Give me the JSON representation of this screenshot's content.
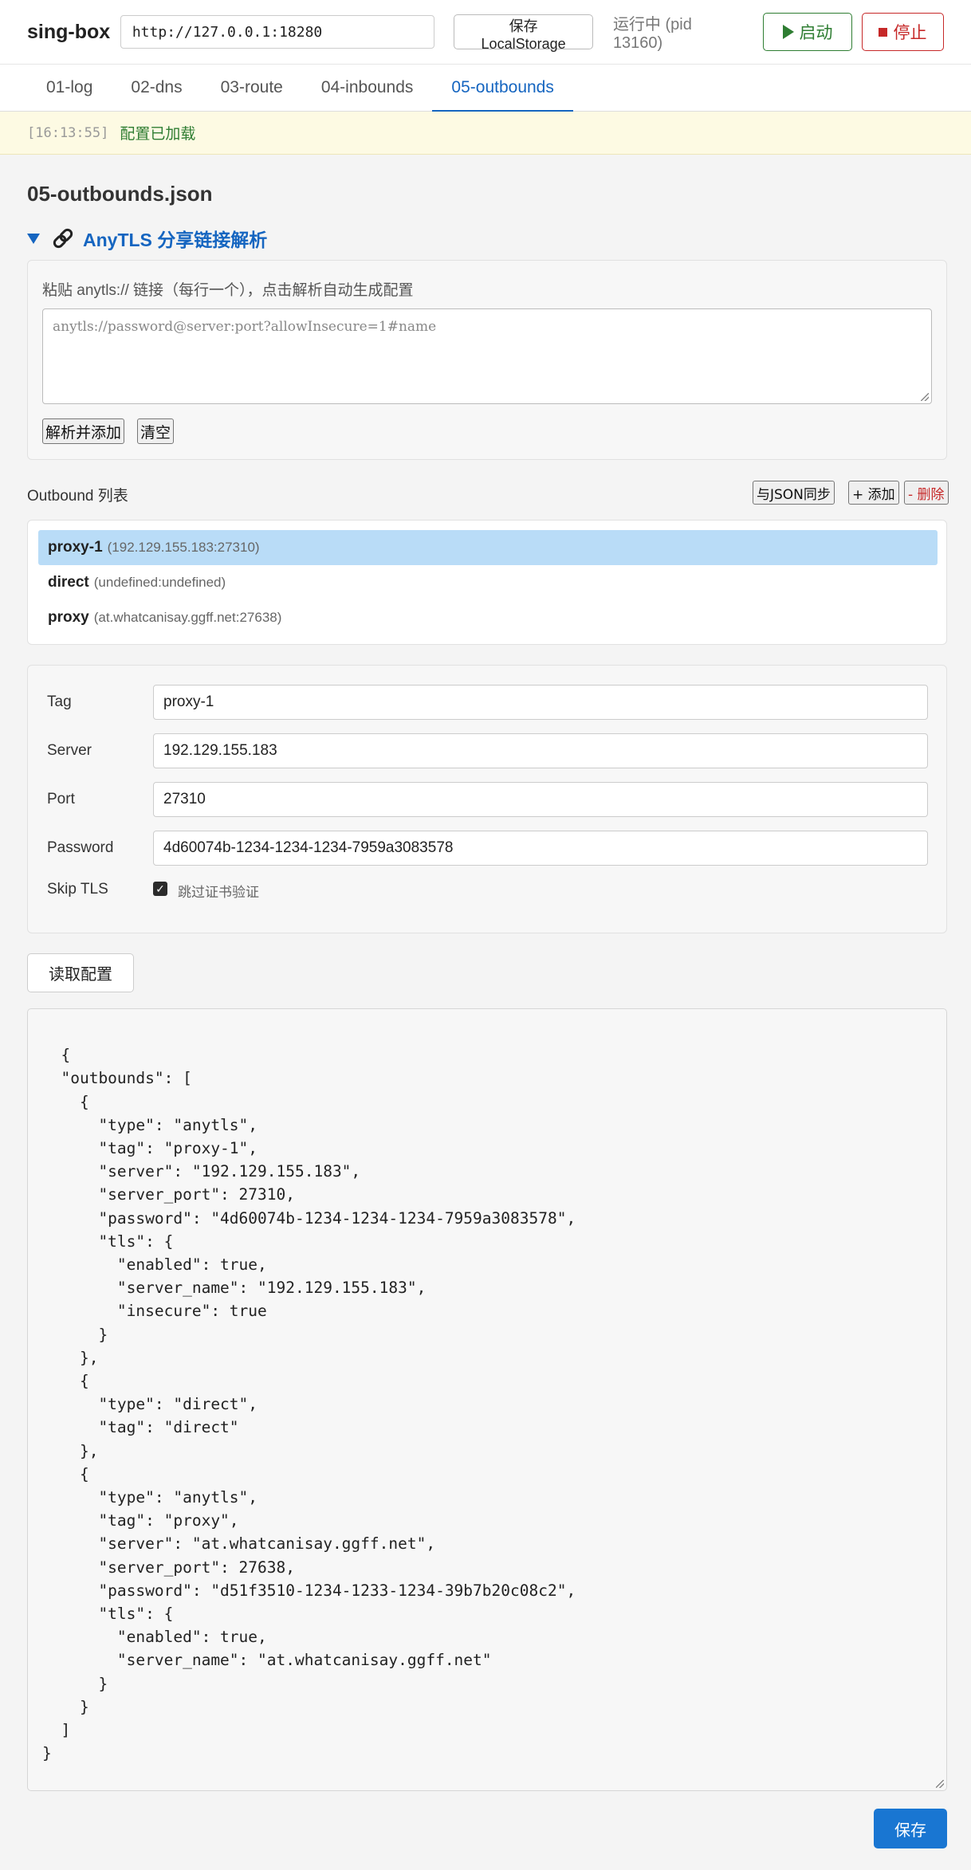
{
  "header": {
    "brand": "sing-box",
    "url_value": "http://127.0.0.1:18280",
    "save_storage_label": "保存LocalStorage",
    "status": "运行中 (pid 13160)",
    "start_label": "启动",
    "stop_label": "停止"
  },
  "tabs": [
    {
      "label": "01-log"
    },
    {
      "label": "02-dns"
    },
    {
      "label": "03-route"
    },
    {
      "label": "04-inbounds"
    },
    {
      "label": "05-outbounds",
      "active": true
    }
  ],
  "notice": {
    "timestamp": "[16:13:55]",
    "message": "配置已加载"
  },
  "page": {
    "title": "05-outbounds.json"
  },
  "parser": {
    "title": "AnyTLS 分享链接解析",
    "hint": "粘贴 anytls:// 链接（每行一个），点击解析自动生成配置",
    "placeholder": "anytls://password@server:port?allowInsecure=1#name",
    "parse_label": "解析并添加",
    "clear_label": "清空"
  },
  "outbound_list": {
    "title": "Outbound 列表",
    "sync_label": "与JSON同步",
    "add_label": "+ 添加",
    "delete_label": "- 删除",
    "items": [
      {
        "tag": "proxy-1",
        "addr": "(192.129.155.183:27310)",
        "selected": true
      },
      {
        "tag": "direct",
        "addr": "(undefined:undefined)"
      },
      {
        "tag": "proxy",
        "addr": "(at.whatcanisay.ggff.net:27638)"
      }
    ]
  },
  "form": {
    "tag_label": "Tag",
    "tag_value": "proxy-1",
    "server_label": "Server",
    "server_value": "192.129.155.183",
    "port_label": "Port",
    "port_value": "27310",
    "password_label": "Password",
    "password_value": "4d60074b-1234-1234-1234-7959a3083578",
    "skip_tls_label": "Skip TLS",
    "skip_tls_checked": true,
    "skip_tls_text": "跳过证书验证"
  },
  "editor": {
    "read_label": "读取配置",
    "save_label": "保存",
    "content": "{\n  \"outbounds\": [\n    {\n      \"type\": \"anytls\",\n      \"tag\": \"proxy-1\",\n      \"server\": \"192.129.155.183\",\n      \"server_port\": 27310,\n      \"password\": \"4d60074b-1234-1234-1234-7959a3083578\",\n      \"tls\": {\n        \"enabled\": true,\n        \"server_name\": \"192.129.155.183\",\n        \"insecure\": true\n      }\n    },\n    {\n      \"type\": \"direct\",\n      \"tag\": \"direct\"\n    },\n    {\n      \"type\": \"anytls\",\n      \"tag\": \"proxy\",\n      \"server\": \"at.whatcanisay.ggff.net\",\n      \"server_port\": 27638,\n      \"password\": \"d51f3510-1234-1233-1234-39b7b20c08c2\",\n      \"tls\": {\n        \"enabled\": true,\n        \"server_name\": \"at.whatcanisay.ggff.net\"\n      }\n    }\n  ]\n}"
  },
  "colors": {
    "accent": "#1565c0",
    "start": "#2e7d32",
    "stop": "#c62828",
    "selected_row": "#b9dcf7",
    "save_button": "#1976d2",
    "notice_bg": "#fdfae3"
  }
}
